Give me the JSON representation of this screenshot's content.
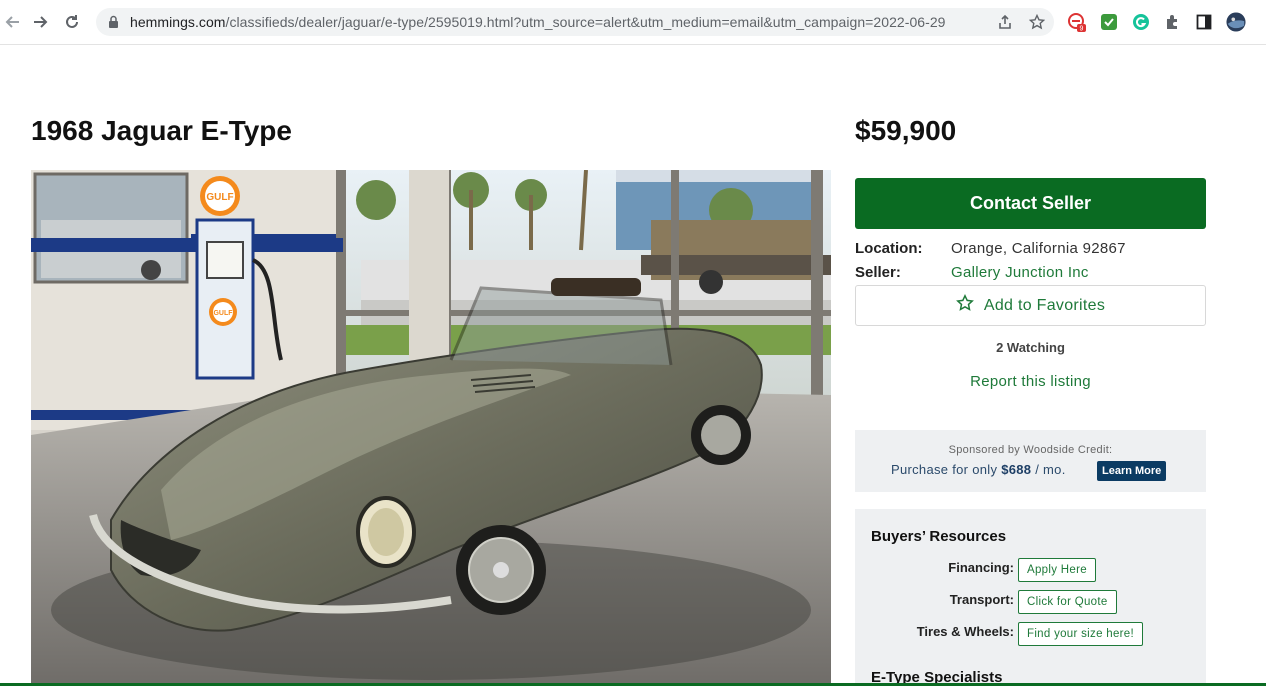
{
  "browser": {
    "url_domain": "hemmings.com",
    "url_path": "/classifieds/dealer/jaguar/e-type/2595019.html?utm_source=alert&utm_medium=email&utm_campaign=2022-06-29",
    "extension_badge": "9"
  },
  "listing": {
    "title": "1968 Jaguar E-Type",
    "price": "$59,900",
    "contact_label": "Contact Seller",
    "location_label": "Location:",
    "location_value": "Orange, California 92867",
    "seller_label": "Seller:",
    "seller_value": "Gallery Junction Inc",
    "favorites_label": "Add to Favorites",
    "watching": "2 Watching",
    "report_label": "Report this listing"
  },
  "sponsor": {
    "line1": "Sponsored by Woodside Credit:",
    "prefix": "Purchase for only",
    "amount": "$688",
    "suffix": "/ mo.",
    "button": "Learn More"
  },
  "resources": {
    "title": "Buyers’ Resources",
    "items": [
      {
        "label": "Financing:",
        "button": "Apply Here"
      },
      {
        "label": "Transport:",
        "button": "Click for Quote"
      },
      {
        "label": "Tires & Wheels:",
        "button": "Find your size here!"
      }
    ],
    "specialists_title": "E-Type Specialists"
  },
  "photo": {
    "gas_pump_sign": "GULF"
  },
  "colors": {
    "brand_green": "#0a6b22",
    "link_green": "#1f7a3a",
    "sponsor_navy": "#0b3b63"
  }
}
